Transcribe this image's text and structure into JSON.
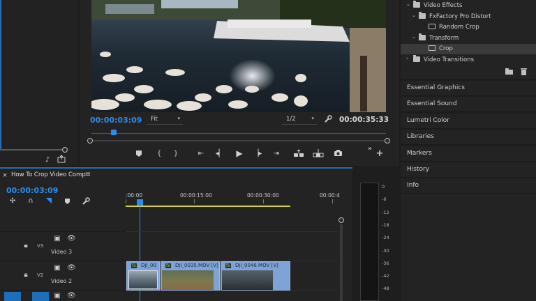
{
  "source_monitor": {
    "bg": "#222222"
  },
  "program_monitor": {
    "current_time": "00:00:03:09",
    "fit": "Fit",
    "resolution": "1/2",
    "duration": "00:00:35:33"
  },
  "effects": {
    "items": [
      {
        "label": "Video Effects",
        "level": 1,
        "type": "folder",
        "expanded": true
      },
      {
        "label": "FxFactory Pro Distort",
        "level": 2,
        "type": "folder",
        "expanded": true
      },
      {
        "label": "Random Crop",
        "level": 3,
        "type": "effect"
      },
      {
        "label": "Transform",
        "level": 2,
        "type": "folder",
        "expanded": true
      },
      {
        "label": "Crop",
        "level": 3,
        "type": "effect",
        "selected": true
      },
      {
        "label": "Video Transitions",
        "level": 1,
        "type": "folder",
        "expanded": false
      }
    ]
  },
  "panels": [
    "Essential Graphics",
    "Essential Sound",
    "Lumetri Color",
    "Libraries",
    "Markers",
    "History",
    "Info"
  ],
  "timeline": {
    "sequence_name": "How To Crop Video Comp",
    "current_time": "00:00:03:09",
    "ruler": [
      ":00:00",
      "00:00:15:00",
      "00:00:30:00",
      "00:00:4"
    ],
    "tracks": [
      {
        "id": "V3",
        "name": "Video 3"
      },
      {
        "id": "V2",
        "name": "Video 2"
      }
    ],
    "clips": [
      {
        "label": "DJI_00",
        "fx": true
      },
      {
        "label": "DJI_0035.MOV [V]",
        "fx": true
      },
      {
        "label": "DJI_0046.MOV [V]",
        "fx": true
      }
    ]
  },
  "audio_meter": {
    "scale": [
      "0",
      "-6",
      "-12",
      "-18",
      "-24",
      "-30",
      "-36",
      "-42",
      "-48"
    ]
  },
  "colors": {
    "accent": "#2d8ceb",
    "clip": "#7ea3d6",
    "work_area": "#d6d238"
  }
}
